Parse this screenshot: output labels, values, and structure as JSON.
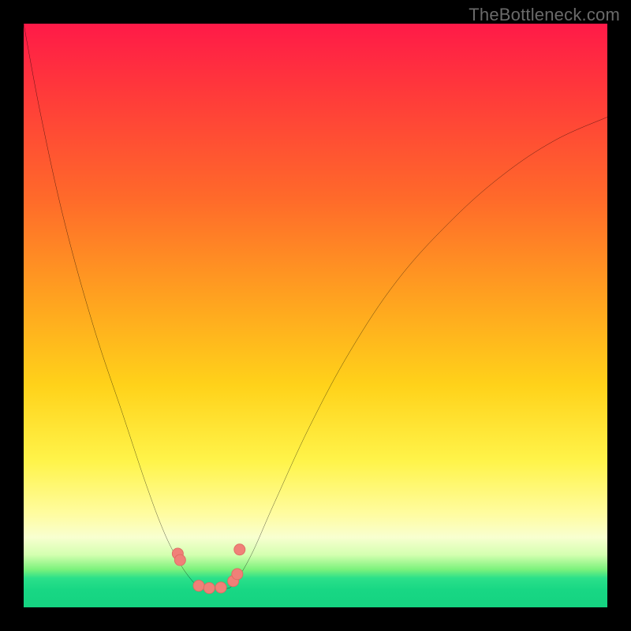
{
  "watermark": {
    "text": "TheBottleneck.com"
  },
  "colors": {
    "page_bg": "#000000",
    "curve": "#000000",
    "marker_fill": "#f08078",
    "marker_stroke": "#de6a62",
    "gradient_stops": [
      "#ff1a48",
      "#ff6a2a",
      "#ffd21a",
      "#fffca0",
      "#2be08a",
      "#15d381"
    ]
  },
  "chart_data": {
    "type": "line",
    "title": "",
    "xlabel": "",
    "ylabel": "",
    "xlim": [
      0,
      100
    ],
    "ylim": [
      0,
      100
    ],
    "notes": "Axes unlabeled; values are relative percentages of the plot area (x left→right, y bottom→top).",
    "series": [
      {
        "name": "left-curve",
        "x": [
          0,
          3,
          7,
          12,
          17,
          21,
          24,
          26.5,
          28.5,
          30,
          31.5
        ],
        "y": [
          100,
          84,
          66,
          48,
          33,
          21,
          13,
          8,
          5,
          3.6,
          3.2
        ]
      },
      {
        "name": "right-curve",
        "x": [
          34.5,
          36,
          39,
          43,
          49,
          56,
          64,
          73,
          82,
          91,
          100
        ],
        "y": [
          3.2,
          4,
          9,
          18,
          31,
          44,
          56,
          66,
          74,
          80,
          84
        ]
      },
      {
        "name": "trough-floor",
        "x": [
          31.5,
          34.5
        ],
        "y": [
          3.2,
          3.2
        ]
      }
    ],
    "markers": {
      "name": "highlighted-points",
      "x_pct": [
        26.4,
        26.8,
        30.0,
        31.8,
        33.8,
        35.9,
        36.6,
        37.0
      ],
      "y_pct": [
        9.2,
        8.1,
        3.7,
        3.3,
        3.4,
        4.5,
        5.7,
        9.9
      ]
    }
  }
}
